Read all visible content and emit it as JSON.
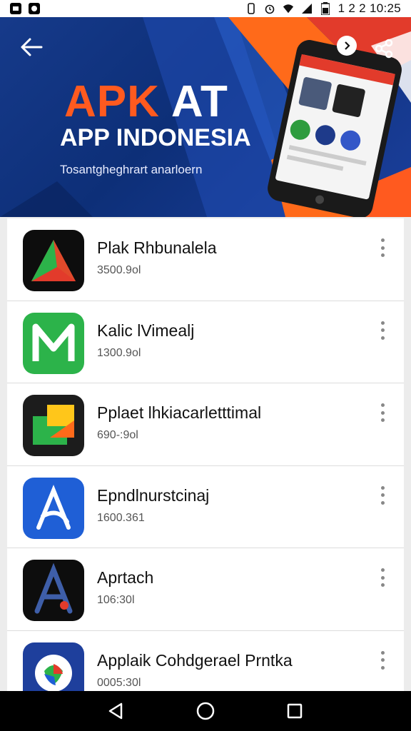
{
  "status_bar": {
    "time": "1 2 2 10:25",
    "icons": [
      "notification-app-icon",
      "photo-app-icon",
      "vibrate-icon",
      "alarm-icon",
      "wifi-icon",
      "signal-icon",
      "battery-icon"
    ]
  },
  "banner": {
    "title_accent": "APK",
    "title_rest": "AT",
    "subtitle": "APP INDONESIA",
    "tagline": "Tosantgheghrart anarloern",
    "colors": {
      "background": "#163a8a",
      "accent_orange": "#ff5a1f",
      "accent_red": "#e23b2b"
    }
  },
  "apps": [
    {
      "name": "Plak Rhbunalela",
      "meta": "3500.9ol",
      "icon": "letter-a-icon"
    },
    {
      "name": "Kalic lVimealj",
      "meta": "1300.9ol",
      "icon": "letter-m-icon"
    },
    {
      "name": "Pplaet lhkiacarletttimal",
      "meta": "690-:9ol",
      "icon": "folder-icon"
    },
    {
      "name": "Epndlnurstcinaj",
      "meta": "1600.361",
      "icon": "pen-a-icon"
    },
    {
      "name": "Aprtach",
      "meta": "106:30l",
      "icon": "chrome-a-icon"
    },
    {
      "name": "Applaik Cohdgerael Prntka",
      "meta": "0005:30l",
      "icon": "photos-icon"
    }
  ],
  "nav_bar": {
    "buttons": [
      "back-triangle-icon",
      "home-circle-icon",
      "recents-square-icon"
    ]
  }
}
